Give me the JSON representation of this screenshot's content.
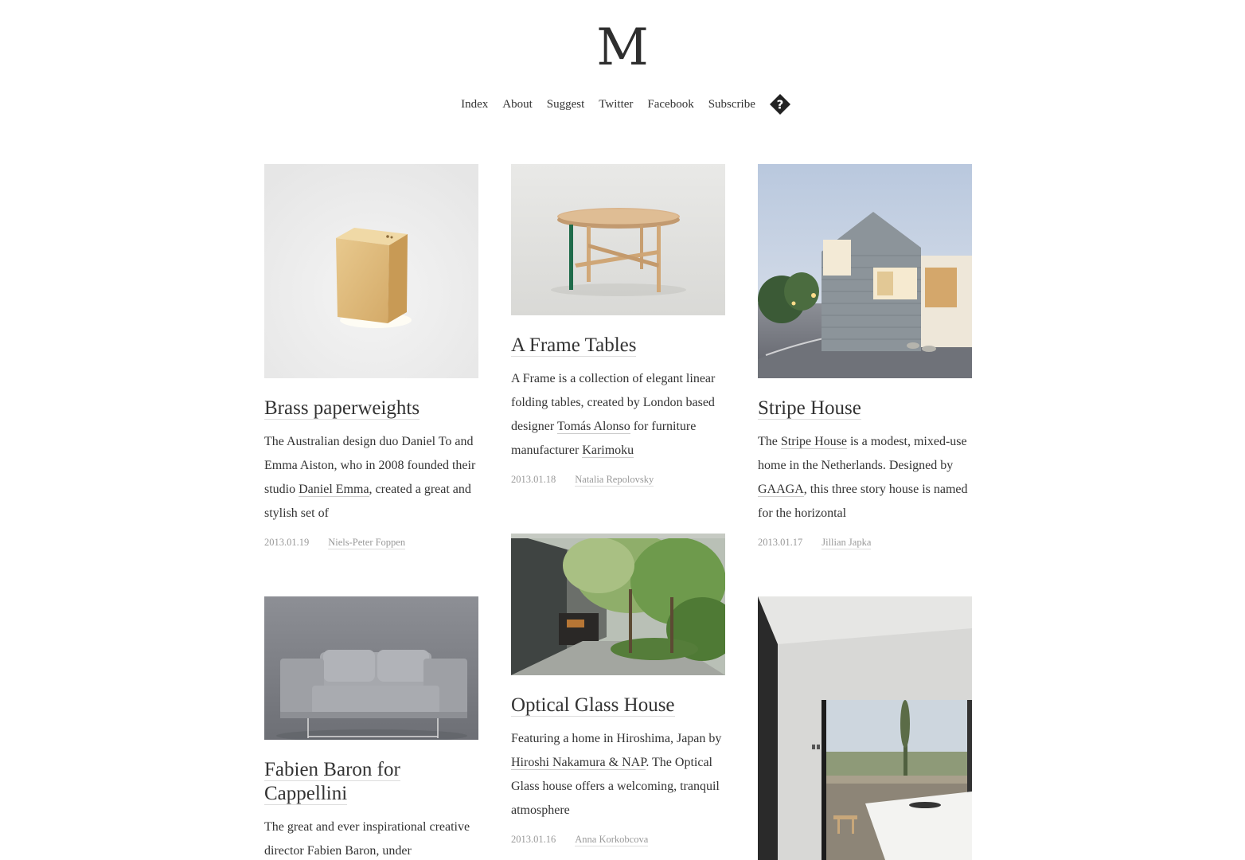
{
  "site": {
    "logo": "M"
  },
  "nav": {
    "items": [
      "Index",
      "About",
      "Suggest",
      "Twitter",
      "Facebook",
      "Subscribe"
    ],
    "help_icon": "question-diamond-icon"
  },
  "posts": [
    {
      "title": "Brass paperweights",
      "excerpt": [
        "The Australian design duo Daniel To and Emma Aiston, who in 2008 founded their studio ",
        "Daniel Emma",
        ", created a great and stylish set of"
      ],
      "date": "2013.01.19",
      "author": "Niels-Peter Foppen"
    },
    {
      "title": "A Frame Tables",
      "excerpt": [
        "A Frame is a collection of elegant linear folding tables, created by London based designer ",
        "Tomás Alonso",
        " for furniture manufacturer ",
        "Karimoku"
      ],
      "date": "2013.01.18",
      "author": "Natalia Repolovsky"
    },
    {
      "title": "Stripe House",
      "excerpt": [
        "The ",
        "Stripe House",
        " is a modest, mixed-use home in the Netherlands. Designed by ",
        "GAAGA",
        ", this three story house is named for the horizontal"
      ],
      "date": "2013.01.17",
      "author": "Jillian Japka"
    },
    {
      "title": "Optical Glass House",
      "excerpt": [
        "Featuring a home in Hiroshima, Japan by ",
        "Hiroshi Nakamura & NAP",
        ". The Optical Glass house offers a welcoming, tranquil atmosphere"
      ],
      "date": "2013.01.16",
      "author": "Anna Korkobcova"
    },
    {
      "title": "Fabien Baron for Cappellini",
      "excerpt": [
        "The great and ever inspirational creative director Fabien Baron, under"
      ],
      "date": "",
      "author": ""
    }
  ],
  "colors": {
    "text": "#333333",
    "meta": "#999999",
    "background": "#ffffff"
  }
}
